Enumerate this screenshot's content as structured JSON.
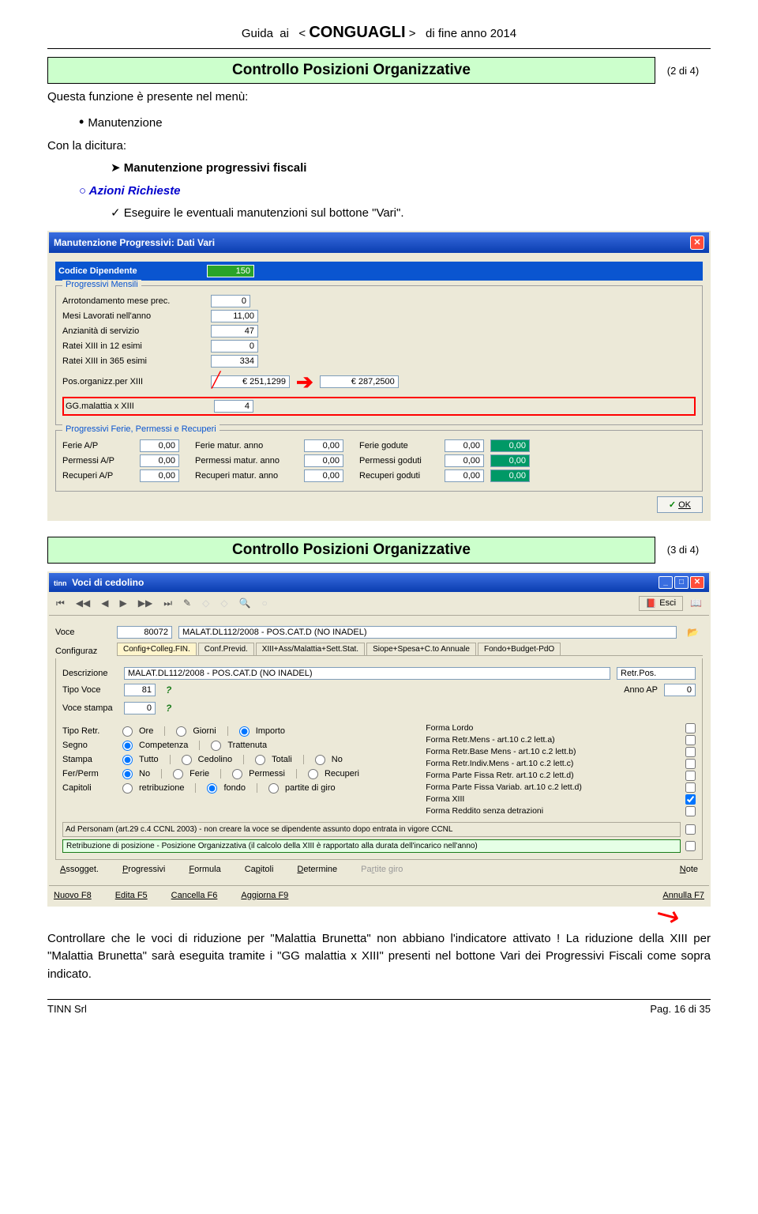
{
  "header": {
    "full": "Guida  ai   < CONGUAGLI >   di fine anno 2014"
  },
  "section1": {
    "title": "Controllo Posizioni Organizzative",
    "page": "(2 di 4)"
  },
  "intro": {
    "l1": "Questa funzione è presente nel menù:",
    "b1": "Manutenzione",
    "l2": "Con la dicitura:",
    "b2": "Manutenzione progressivi fiscali",
    "b3": "Azioni Richieste",
    "b4": "Eseguire le eventuali manutenzioni sul bottone \"Vari\"."
  },
  "win1": {
    "title": "Manutenzione Progressivi: Dati Vari",
    "codice_lbl": "Codice Dipendente",
    "codice_val": "150",
    "fs1_legend": "Progressivi Mensili",
    "rows": [
      {
        "l": "Arrotondamento mese prec.",
        "v": "0"
      },
      {
        "l": "Mesi Lavorati  nell'anno",
        "v": "11,00"
      },
      {
        "l": "Anzianità di servizio",
        "v": "47"
      },
      {
        "l": "Ratei XIII in 12 esimi",
        "v": "0"
      },
      {
        "l": "Ratei XIII in 365 esimi",
        "v": "334"
      }
    ],
    "pos_lbl": "Pos.organizz.per XIII",
    "pos_old": "€ 251,1299",
    "pos_new": "€ 287,2500",
    "gg_lbl": "GG.malattia x XIII",
    "gg_val": "4",
    "fs2_legend": "Progressivi Ferie, Permessi e Recuperi",
    "frow1": {
      "a": "Ferie A/P",
      "av": "0,00",
      "b": "Ferie matur. anno",
      "bv": "0,00",
      "c": "Ferie godute",
      "cv": "0,00",
      "dv": "0,00"
    },
    "frow2": {
      "a": "Permessi A/P",
      "av": "0,00",
      "b": "Permessi matur. anno",
      "bv": "0,00",
      "c": "Permessi goduti",
      "cv": "0,00",
      "dv": "0,00"
    },
    "frow3": {
      "a": "Recuperi A/P",
      "av": "0,00",
      "b": "Recuperi matur. anno",
      "bv": "0,00",
      "c": "Recuperi goduti",
      "cv": "0,00",
      "dv": "0,00"
    },
    "ok": "OK"
  },
  "section2": {
    "title": "Controllo Posizioni Organizzative",
    "page": "(3 di 4)"
  },
  "win2": {
    "title": "Voci di cedolino",
    "esci": "Esci",
    "voce_lbl": "Voce",
    "voce_val": "80072",
    "voce_desc": "MALAT.DL112/2008 - POS.CAT.D (NO INADEL)",
    "config_lbl": "Configuraz",
    "tabs": [
      "Config+Colleg.FIN.",
      "Conf.Previd.",
      "XIII+Ass/Malattia+Sett.Stat.",
      "Siope+Spesa+C.to Annuale",
      "Fondo+Budget-PdO"
    ],
    "desc_lbl": "Descrizione",
    "desc_val": "MALAT.DL112/2008 - POS.CAT.D (NO INADEL)",
    "retr": "Retr.Pos.",
    "tipo_lbl": "Tipo Voce",
    "tipo_val": "81",
    "anno_lbl": "Anno AP",
    "anno_val": "0",
    "stampa_lbl": "Voce stampa",
    "stampa_val": "0",
    "labels": {
      "tiporetr": "Tipo Retr.",
      "r_ore": "Ore",
      "r_giorni": "Giorni",
      "r_importo": "Importo",
      "segno": "Segno",
      "r_comp": "Competenza",
      "r_trat": "Trattenuta",
      "stampa": "Stampa",
      "r_tutto": "Tutto",
      "r_ced": "Cedolino",
      "r_tot": "Totali",
      "r_no": "No",
      "ferperm": "Fer/Perm",
      "r_no2": "No",
      "r_ferie": "Ferie",
      "r_perm": "Permessi",
      "r_rec": "Recuperi",
      "capitoli": "Capitoli",
      "r_retr": "retribuzione",
      "r_fondo": "fondo",
      "r_part": "partite di giro"
    },
    "checks": [
      "Forma Lordo",
      "Forma Retr.Mens - art.10 c.2 lett.a)",
      "Forma Retr.Base Mens - art.10 c.2 lett.b)",
      "Forma Retr.Indiv.Mens - art.10 c.2 lett.c)",
      "Forma Parte Fissa Retr. art.10 c.2 lett.d)",
      "Forma Parte Fissa Variab. art.10 c.2 lett.d)",
      "Forma XIII",
      "Forma Reddito senza detrazioni"
    ],
    "row_ad": "Ad Personam (art.29 c.4 CCNL 2003) - non creare la voce se dipendente assunto dopo entrata in vigore CCNL",
    "row_retr": "Retribuzione di posizione - Posizione Organizzativa  (il calcolo della XIII è rapportato alla durata dell'incarico nell'anno)",
    "btns": [
      "Assogget.",
      "Progressivi",
      "Formula",
      "Capitoli",
      "Determine",
      "Partite giro",
      "Note"
    ],
    "bbtns": [
      "Nuovo F8",
      "Edita F5",
      "Cancella F6",
      "Aggiorna F9"
    ],
    "annulla": "Annulla F7"
  },
  "para": "Controllare che le voci di riduzione per \"Malattia Brunetta\" non abbiano l'indicatore attivato ! La riduzione della XIII per \"Malattia Brunetta\" sarà eseguita tramite i \"GG malattia x XIII\" presenti nel bottone Vari dei Progressivi Fiscali come sopra indicato.",
  "footer": {
    "left": "TINN  Srl",
    "right": "Pag.  16 di 35"
  }
}
